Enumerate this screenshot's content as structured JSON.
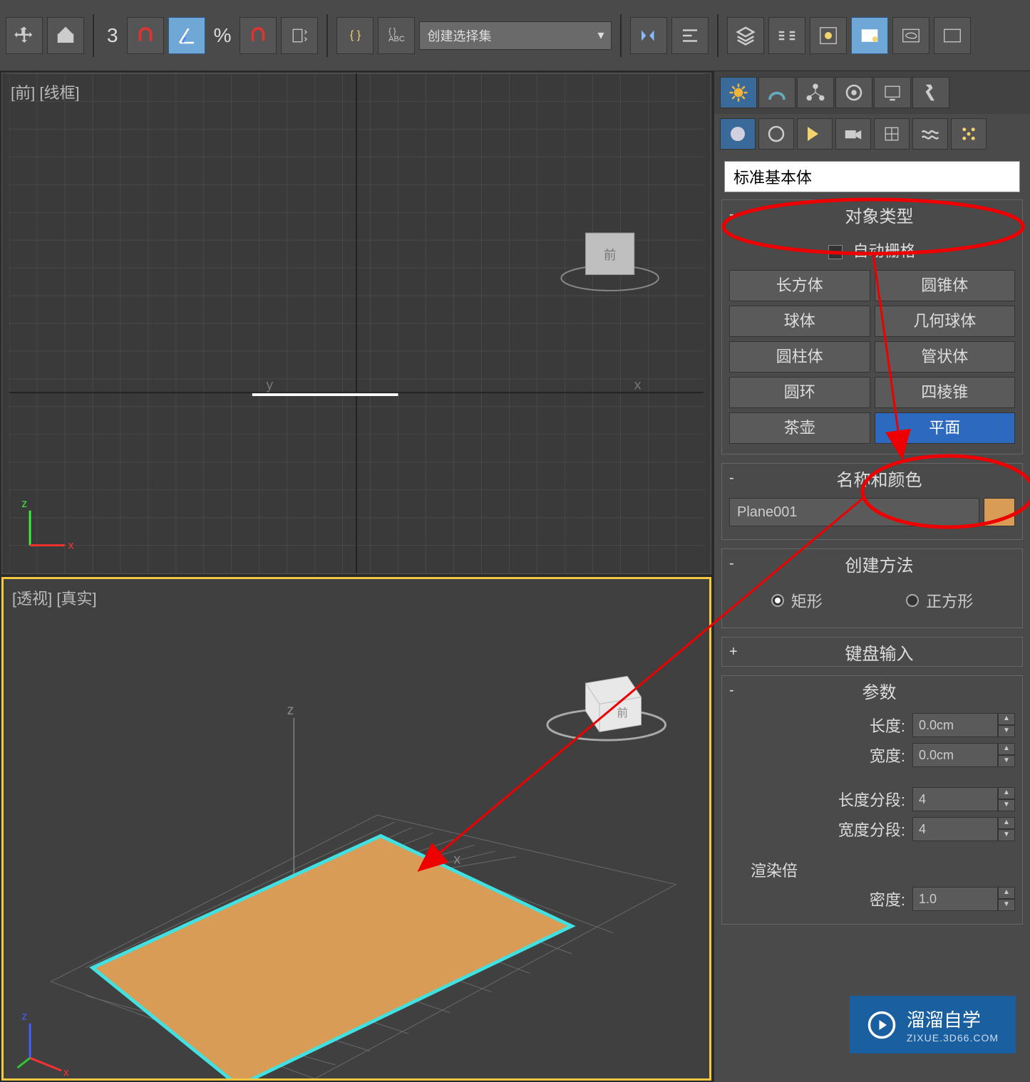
{
  "toolbar": {
    "number_label": "3",
    "selection_set_placeholder": "创建选择集",
    "icons": [
      "move-axis",
      "object",
      "snap-angle",
      "snap-percent",
      "spinner",
      "curly-abc",
      "mirror",
      "align",
      "layers",
      "schematic",
      "material-editor",
      "render",
      "render-setup",
      "render-output"
    ]
  },
  "viewports": {
    "front": {
      "label": "[前] [线框]"
    },
    "perspective": {
      "label": "[透视] [真实]"
    }
  },
  "create_panel": {
    "tabs": [
      "create",
      "modify",
      "hierarchy",
      "motion",
      "display",
      "utilities"
    ],
    "subtabs": [
      "geometry",
      "shapes",
      "lights",
      "cameras",
      "helpers",
      "space-warps",
      "systems"
    ],
    "category": "标准基本体",
    "object_type": {
      "title": "对象类型",
      "auto_grid": "自动栅格",
      "buttons": [
        [
          "长方体",
          "圆锥体"
        ],
        [
          "球体",
          "几何球体"
        ],
        [
          "圆柱体",
          "管状体"
        ],
        [
          "圆环",
          "四棱锥"
        ],
        [
          "茶壶",
          "平面"
        ]
      ],
      "selected": "平面"
    },
    "name_color": {
      "title": "名称和颜色",
      "name": "Plane001",
      "color": "#d89c56"
    },
    "creation_method": {
      "title": "创建方法",
      "options": [
        "矩形",
        "正方形"
      ],
      "selected": "矩形"
    },
    "keyboard_entry": {
      "title": "键盘输入"
    },
    "parameters": {
      "title": "参数",
      "length_label": "长度:",
      "length_value": "0.0cm",
      "width_label": "宽度:",
      "width_value": "0.0cm",
      "length_segs_label": "长度分段:",
      "length_segs_value": "4",
      "width_segs_label": "宽度分段:",
      "width_segs_value": "4",
      "render_scale_label": "渲染倍",
      "density_label": "密度:",
      "density_value": "1.0"
    }
  },
  "watermark": {
    "brand": "溜溜自学",
    "url": "ZIXUE.3D66.COM"
  }
}
